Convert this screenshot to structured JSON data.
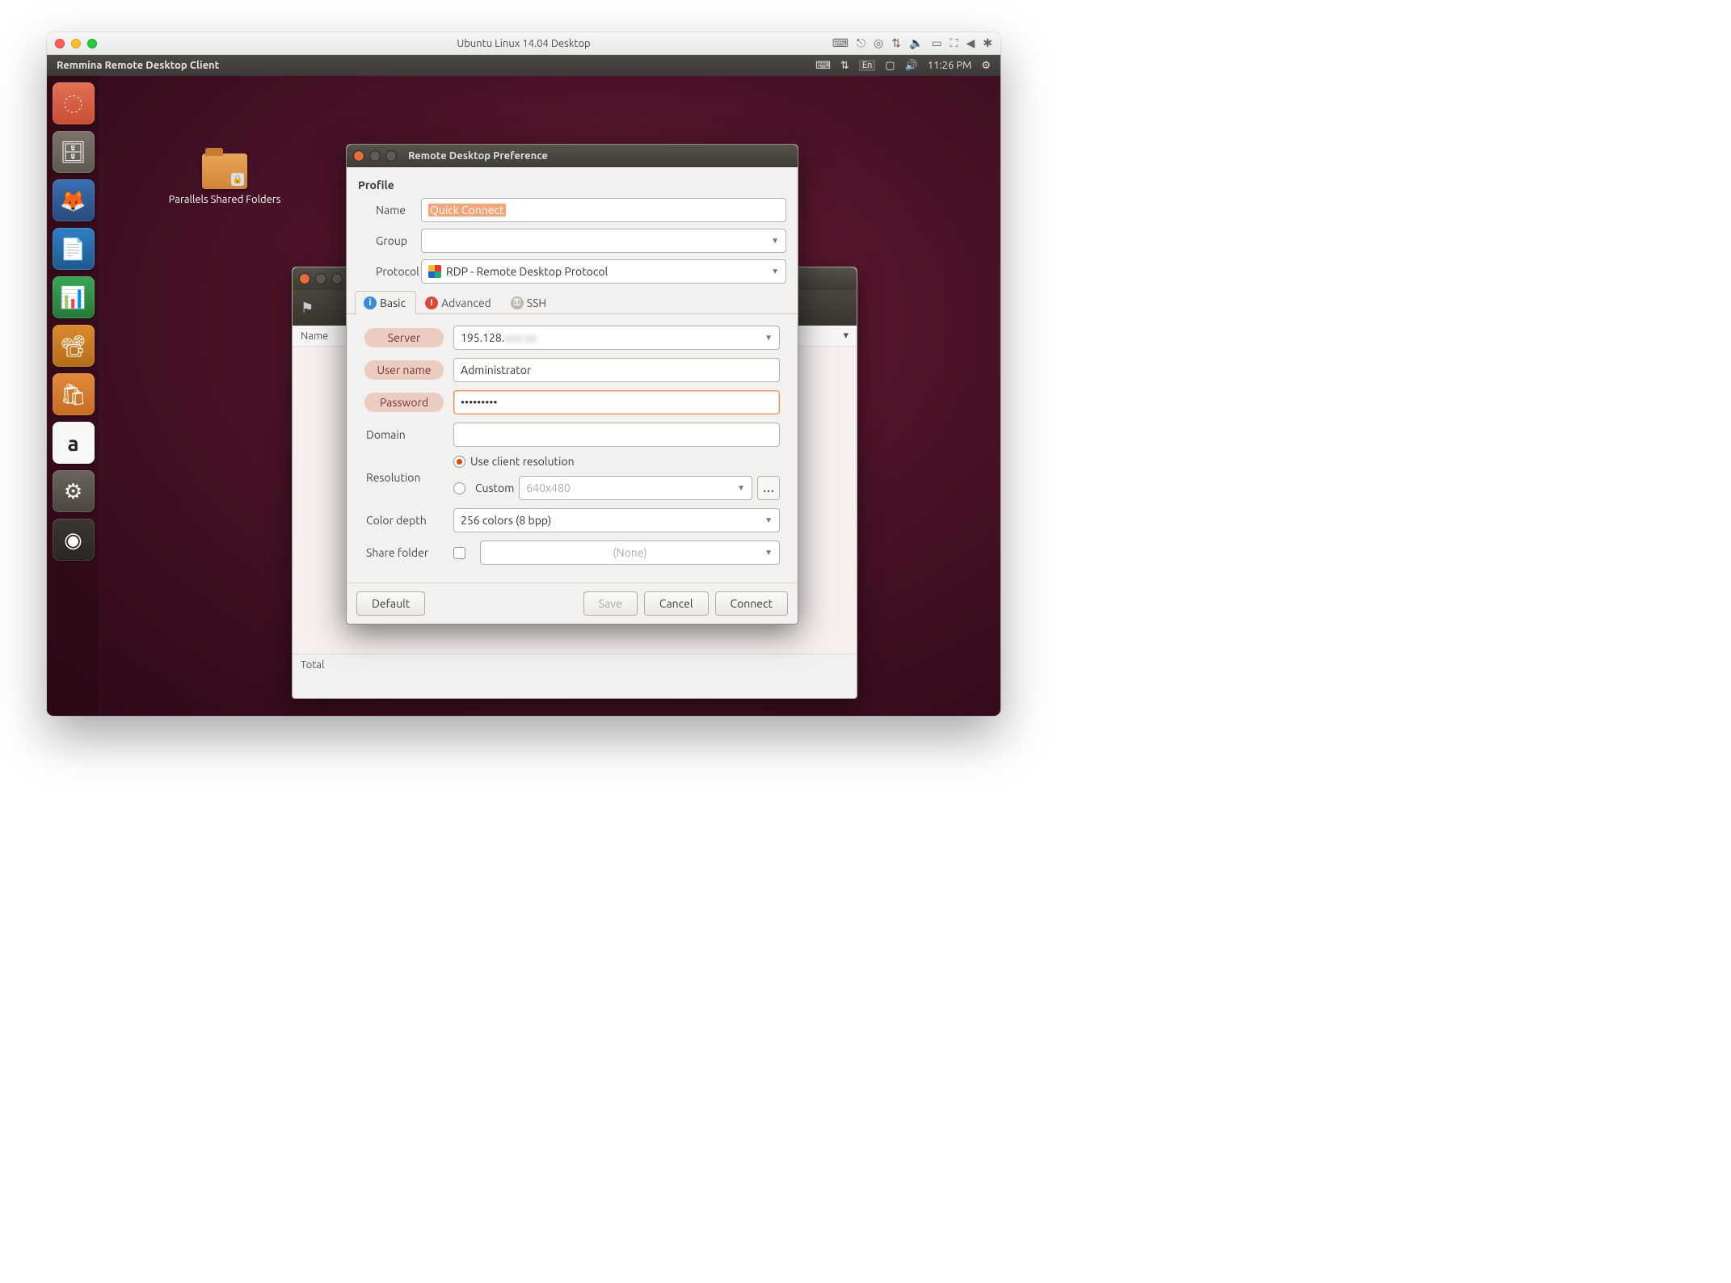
{
  "mac": {
    "title": "Ubuntu Linux 14.04 Desktop"
  },
  "ubuntu": {
    "menubar_title": "Remmina Remote Desktop Client",
    "indicators": {
      "lang": "En",
      "time": "11:26 PM"
    }
  },
  "desktop": {
    "shared_folders_label": "Parallels Shared Folders"
  },
  "remmina_main": {
    "col_name": "Name",
    "footer": "Total"
  },
  "dialog": {
    "title": "Remote Desktop Preference",
    "section_profile": "Profile",
    "labels": {
      "name": "Name",
      "group": "Group",
      "protocol": "Protocol"
    },
    "name_value": "Quick Connect",
    "group_value": "",
    "protocol_value": "RDP - Remote Desktop Protocol",
    "tabs": {
      "basic": "Basic",
      "advanced": "Advanced",
      "ssh": "SSH"
    },
    "basic": {
      "server_label": "Server",
      "server_value_prefix": "195.128.",
      "username_label": "User name",
      "username_value": "Administrator",
      "password_label": "Password",
      "password_value": "•••••••••",
      "domain_label": "Domain",
      "domain_value": "",
      "resolution_label": "Resolution",
      "resolution_client": "Use client resolution",
      "resolution_custom": "Custom",
      "resolution_custom_value": "640x480",
      "color_label": "Color depth",
      "color_value": "256 colors (8 bpp)",
      "share_label": "Share folder",
      "share_value": "(None)"
    },
    "buttons": {
      "default": "Default",
      "save": "Save",
      "cancel": "Cancel",
      "connect": "Connect"
    }
  }
}
